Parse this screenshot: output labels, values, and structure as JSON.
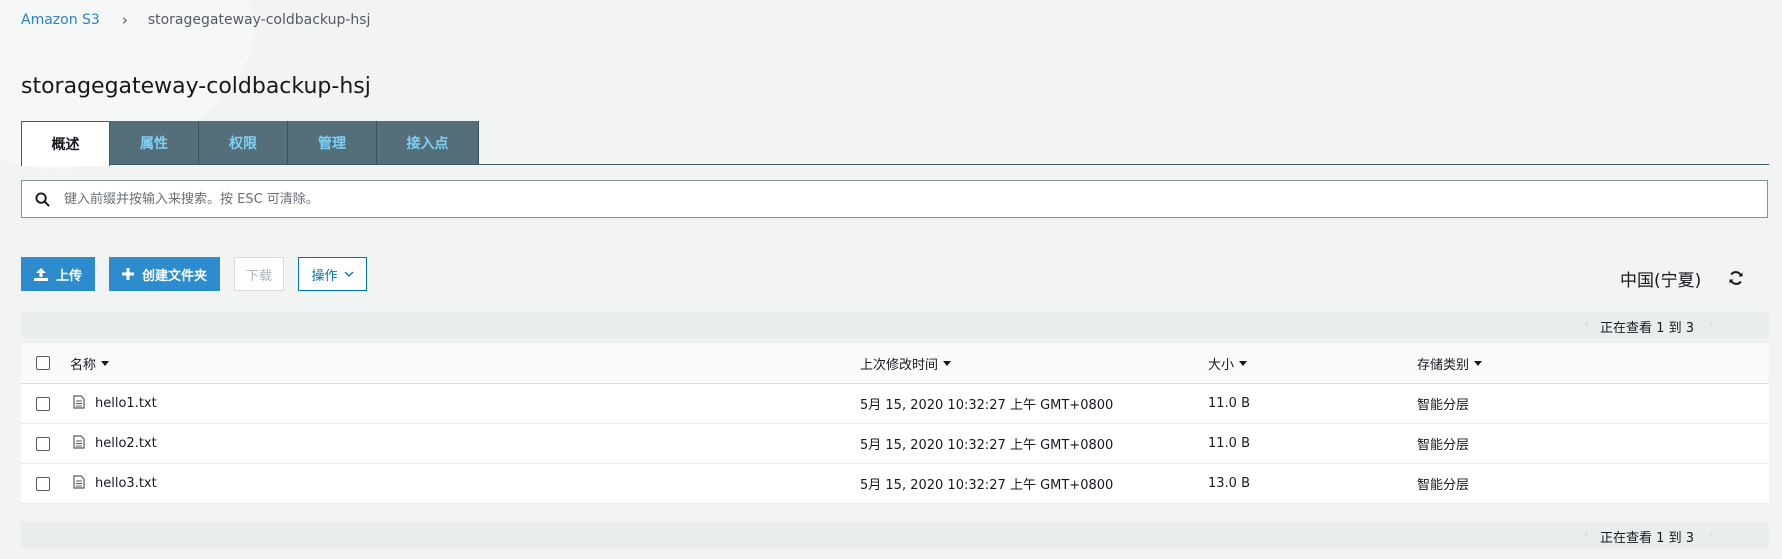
{
  "breadcrumb": {
    "root": "Amazon S3",
    "separator": "›",
    "current": "storagegateway-coldbackup-hsj"
  },
  "page_title": "storagegateway-coldbackup-hsj",
  "tabs": [
    {
      "label": "概述",
      "active": true
    },
    {
      "label": "属性",
      "active": false
    },
    {
      "label": "权限",
      "active": false
    },
    {
      "label": "管理",
      "active": false
    },
    {
      "label": "接入点",
      "active": false
    }
  ],
  "search": {
    "placeholder": "键入前缀并按输入来搜索。按 ESC 可清除。",
    "icon": "search-icon"
  },
  "toolbar": {
    "upload_label": "上传",
    "create_folder_label": "创建文件夹",
    "download_label": "下载",
    "actions_label": "操作"
  },
  "region": "中国(宁夏)",
  "pager": {
    "text": "正在查看 1 到 3"
  },
  "table": {
    "columns": [
      "名称",
      "上次修改时间",
      "大小",
      "存储类别"
    ],
    "rows": [
      {
        "name": "hello1.txt",
        "modified": "5月 15, 2020 10:32:27 上午 GMT+0800",
        "size": "11.0 B",
        "storage_class": "智能分层"
      },
      {
        "name": "hello2.txt",
        "modified": "5月 15, 2020 10:32:27 上午 GMT+0800",
        "size": "11.0 B",
        "storage_class": "智能分层"
      },
      {
        "name": "hello3.txt",
        "modified": "5月 15, 2020 10:32:27 上午 GMT+0800",
        "size": "13.0 B",
        "storage_class": "智能分层"
      }
    ]
  },
  "colors": {
    "link": "#2a83c5",
    "primary": "#2d8ccd",
    "tab_bg": "#546e7a",
    "tab_text": "#7fd0f5"
  }
}
